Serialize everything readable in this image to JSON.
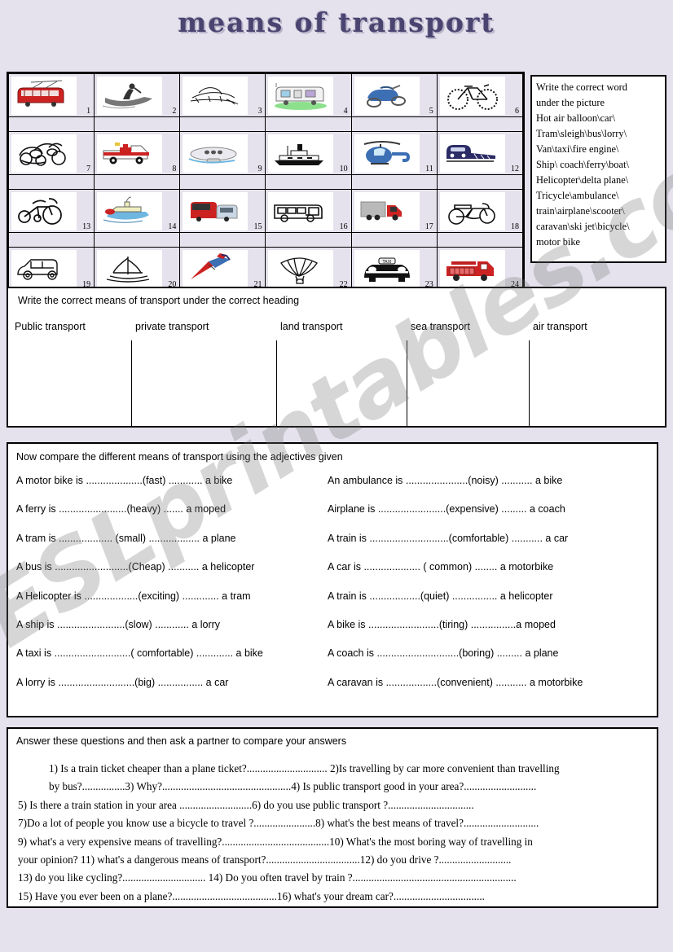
{
  "title": "means  of  transport",
  "watermark": "ESLprintables.com",
  "wordbank": {
    "lines": [
      "Write the correct word",
      "under the picture",
      "Hot air balloon\\car\\",
      "Tram\\sleigh\\bus\\lorry\\",
      "Van\\taxi\\fire engine\\",
      "Ship\\ coach\\ferry\\boat\\",
      "Helicopter\\delta plane\\",
      "Tricycle\\ambulance\\",
      "train\\airplane\\scooter\\",
      "caravan\\ski jet\\bicycle\\",
      "motor bike"
    ]
  },
  "grid": {
    "items": [
      {
        "num": "1",
        "icon": "tram-icon"
      },
      {
        "num": "2",
        "icon": "jetski-icon"
      },
      {
        "num": "3",
        "icon": "sleigh-icon"
      },
      {
        "num": "4",
        "icon": "caravan-icon"
      },
      {
        "num": "5",
        "icon": "scooter-icon"
      },
      {
        "num": "6",
        "icon": "bicycle-icon"
      },
      {
        "num": "7",
        "icon": "cars-crowd-icon"
      },
      {
        "num": "8",
        "icon": "ambulance-icon"
      },
      {
        "num": "9",
        "icon": "airship-icon"
      },
      {
        "num": "10",
        "icon": "ship-icon"
      },
      {
        "num": "11",
        "icon": "helicopter-icon"
      },
      {
        "num": "12",
        "icon": "train-icon"
      },
      {
        "num": "13",
        "icon": "tricycle-icon"
      },
      {
        "num": "14",
        "icon": "ferry-icon"
      },
      {
        "num": "15",
        "icon": "coach-icon"
      },
      {
        "num": "16",
        "icon": "bus-icon"
      },
      {
        "num": "17",
        "icon": "lorry-icon"
      },
      {
        "num": "18",
        "icon": "motorbike-icon"
      },
      {
        "num": "19",
        "icon": "car-icon"
      },
      {
        "num": "20",
        "icon": "sailboat-icon"
      },
      {
        "num": "21",
        "icon": "delta-plane-icon"
      },
      {
        "num": "22",
        "icon": "hot-air-balloon-icon"
      },
      {
        "num": "23",
        "icon": "taxi-icon"
      },
      {
        "num": "24",
        "icon": "fire-engine-icon"
      }
    ]
  },
  "classify": {
    "instruction": "Write the correct means of transport under the correct heading",
    "columns": [
      {
        "label": "Public transport"
      },
      {
        "label": "private transport"
      },
      {
        "label": "land transport"
      },
      {
        "label": "sea transport"
      },
      {
        "label": "air transport"
      }
    ]
  },
  "compare": {
    "instruction": "Now compare the different means of transport using the adjectives given",
    "left": [
      "A motor bike is ....................(fast) ............  a bike",
      "  A ferry is ........................(heavy) .......   a moped",
      "A tram is ................... (small) .................. a plane",
      "A bus is ..........................(Cheap) ........... a helicopter",
      "A Helicopter is ...................(exciting) ............. a tram",
      "A ship is ........................(slow) ............ a lorry",
      "A taxi is ...........................( comfortable) ............. a bike",
      "A lorry is ...........................(big) ................ a car"
    ],
    "right": [
      "An ambulance is ......................(noisy) ........... a bike",
      "  Airplane is ........................(expensive) ......... a coach",
      "A train is ............................(comfortable) ........... a car",
      "   A car is .................... ( common) ........ a motorbike",
      "A train is ..................(quiet) ................ a helicopter",
      "  A bike is .........................(tiring) ................a moped",
      "    A coach is .............................(boring) ......... a plane",
      "  A caravan is ..................(convenient) ........... a motorbike"
    ]
  },
  "questions": {
    "instruction": "Answer these questions and then ask a partner to compare your answers",
    "lines": [
      "1)   Is a train ticket cheaper than a plane ticket?.............................. 2)Is travelling by car more convenient  than travelling",
      "by bus?................3) Why?................................................4) Is public transport good in your area?...........................",
      "5)   Is there a train station in your area ...........................6) do you use public transport ?................................",
      "7)Do a lot of people you know use a bicycle to travel ?.......................8) what's the best means of travel?............................",
      "9) what's a very expensive means of travelling?........................................10) What's the most boring way of travelling in",
      "your opinion? 11) what's a dangerous means of transport?...................................12) do you drive ?...........................",
      "13) do you like cycling?............................... 14) Do you often travel by train ?.............................................................",
      "15) Have you ever been on a plane?.......................................16) what's your dream car?.................................."
    ]
  },
  "colors": {
    "page_background": "#e5e2ed",
    "title": "#4a4470",
    "title_shadow": "#b8b3c8",
    "box_background": "#ffffff",
    "border": "#000000",
    "watermark": "#c8c8c8",
    "red": "#cc2222",
    "blue": "#3c6fb4",
    "navy": "#2b2b66"
  }
}
